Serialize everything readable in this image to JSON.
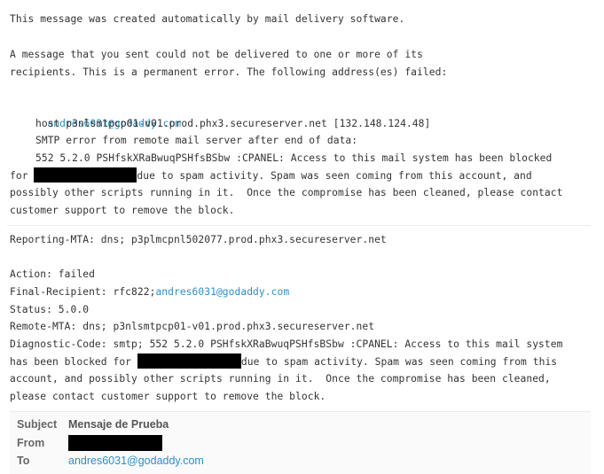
{
  "bounce": {
    "intro": "This message was created automatically by mail delivery software.",
    "notice_line1": "A message that you sent could not be delivered to one or more of its",
    "notice_line2": "recipients. This is a permanent error. The following address(es) failed:",
    "failed_address": "andres6031@godaddy.com",
    "host_line": "host p3nlsmtpcp01-v01.prod.phx3.secureserver.net [132.148.124.48]",
    "smtp_error_line": "SMTP error from remote mail server after end of data:",
    "code_line": "552 5.2.0 PSHfskXRaBwuqPSHfsBSbw :CPANEL: Access to this mail system has been blocked",
    "for_prefix": "for ",
    "for_suffix": "due to spam activity. Spam was seen coming from this account, and",
    "possibly_line": "possibly other scripts running in it.  Once the compromise has been cleaned, please contact",
    "support_line": "customer support to remove the block."
  },
  "report": {
    "reporting_mta": "Reporting-MTA: dns; p3plmcpnl502077.prod.phx3.secureserver.net",
    "action": "Action: failed",
    "final_recipient_prefix": "Final-Recipient: rfc822;",
    "final_recipient_address": "andres6031@godaddy.com",
    "status": "Status: 5.0.0",
    "remote_mta": "Remote-MTA: dns; p3nlsmtpcp01-v01.prod.phx3.secureserver.net",
    "diagnostic_line1": "Diagnostic-Code: smtp; 552 5.2.0 PSHfskXRaBwuqPSHfsBSbw :CPANEL: Access to this mail system",
    "diagnostic_prefix": "has been blocked for ",
    "diagnostic_suffix": "due to spam activity. Spam was seen coming from this",
    "diagnostic_line3": "account, and possibly other scripts running in it.  Once the compromise has been cleaned,",
    "diagnostic_line4": "please contact customer support to remove the block."
  },
  "original_message": {
    "subject_label": "Subject",
    "subject_value": "Mensaje de Prueba",
    "from_label": "From",
    "from_value": "",
    "to_label": "To",
    "to_value": "andres6031@godaddy.com"
  },
  "colors": {
    "link": "#2f8fc4",
    "text": "#333333",
    "redaction": "#000000"
  }
}
